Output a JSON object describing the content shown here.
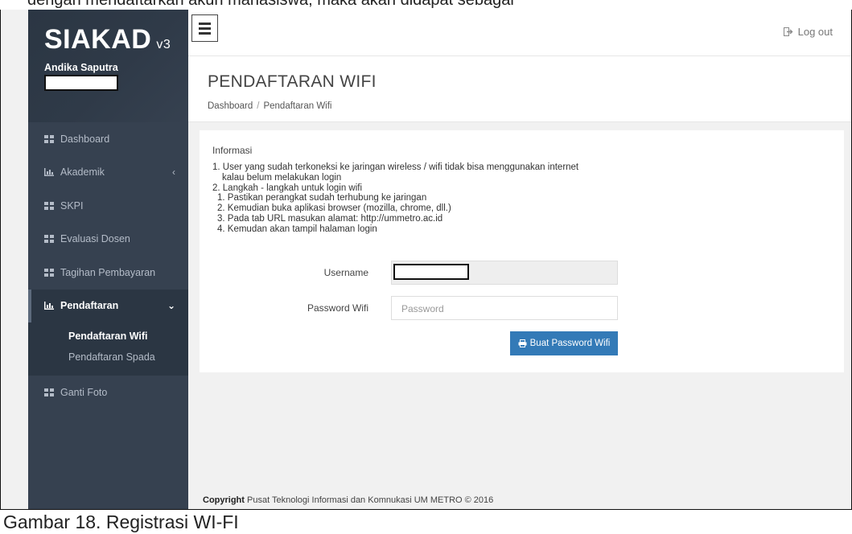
{
  "document": {
    "top_caption": "dengan mendaftarkan akun mahasiswa, maka akan didapat sebagai",
    "bottom_caption": "Gambar 18. Registrasi WI-FI"
  },
  "brand": {
    "name": "SIAKAD",
    "version": "v3"
  },
  "user": {
    "name": "Andika Saputra"
  },
  "sidebar": {
    "items": [
      {
        "label": "Dashboard",
        "icon": "grid-icon"
      },
      {
        "label": "Akademik",
        "icon": "bar-chart-icon",
        "chevron": "‹"
      },
      {
        "label": "SKPI",
        "icon": "grid-icon"
      },
      {
        "label": "Evaluasi Dosen",
        "icon": "grid-icon"
      },
      {
        "label": "Tagihan Pembayaran",
        "icon": "grid-icon"
      },
      {
        "label": "Pendaftaran",
        "icon": "bar-chart-icon",
        "chevron": "⌄",
        "active": true,
        "children": [
          {
            "label": "Pendaftaran Wifi",
            "current": true
          },
          {
            "label": "Pendaftaran Spada"
          }
        ]
      },
      {
        "label": "Ganti Foto",
        "icon": "grid-icon"
      }
    ]
  },
  "topbar": {
    "logout_label": "Log out"
  },
  "page": {
    "title": "PENDAFTARAN WIFI",
    "breadcrumb": [
      "Dashboard",
      "Pendaftaran Wifi"
    ]
  },
  "panel": {
    "title": "Informasi",
    "info_lines": [
      "1. User yang sudah terkoneksi ke jaringan wireless / wifi tidak bisa menggunakan internet",
      "kalau belum melakukan login",
      "2. Langkah - langkah untuk login wifi",
      "1. Pastikan perangkat sudah terhubung ke jaringan",
      "2. Kemudian buka aplikasi browser (mozilla, chrome, dll.)",
      "3. Pada tab URL masukan alamat: http://ummetro.ac.id",
      "4. Kemudan akan tampil halaman login"
    ],
    "username_label": "Username",
    "password_label": "Password Wifi",
    "password_placeholder": "Password",
    "submit_label": "Buat Password Wifi"
  },
  "footer": {
    "copyright_bold": "Copyright",
    "copyright_text": "Pusat Teknologi Informasi dan Komnukasi UM METRO © 2016"
  },
  "colors": {
    "sidebar_bg": "#364150",
    "sidebar_dark": "#2b3643",
    "primary": "#337ab7"
  }
}
